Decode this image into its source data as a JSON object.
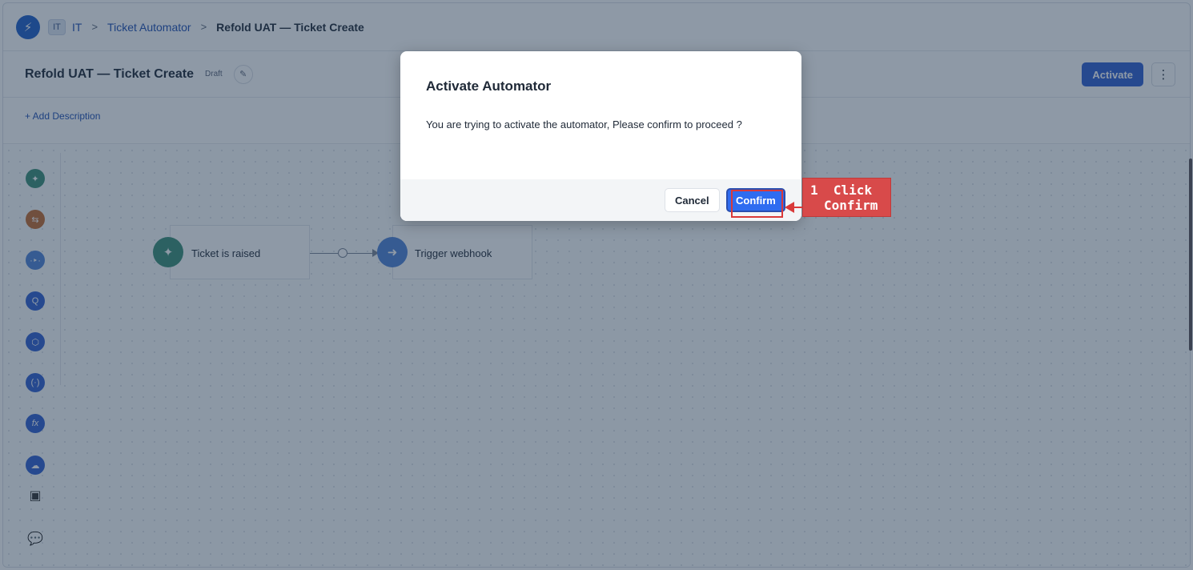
{
  "topbar": {
    "workspace_badge": "IT",
    "breadcrumbs": [
      "IT",
      "Ticket Automator",
      "Refold UAT — Ticket Create"
    ],
    "separator": ">"
  },
  "header": {
    "title": "Refold UAT — Ticket Create",
    "status": "Draft",
    "activate_label": "Activate",
    "more_label": "⋮"
  },
  "description": {
    "add_label": "+ Add Description"
  },
  "canvas": {
    "nodes": [
      {
        "label": "Ticket is raised",
        "icon": "trigger-icon"
      },
      {
        "label": "Trigger webhook",
        "icon": "arrow-right-icon"
      }
    ],
    "tools": [
      {
        "icon": "trigger-icon",
        "color": "#3a8f76"
      },
      {
        "icon": "switch-icon",
        "color": "#c26a2e"
      },
      {
        "icon": "webhook-icon",
        "color": "#4e82d6"
      },
      {
        "icon": "query-icon",
        "color": "#2f5fd0"
      },
      {
        "icon": "box-icon",
        "color": "#2f5fd0"
      },
      {
        "icon": "variable-icon",
        "color": "#2f5fd0"
      },
      {
        "icon": "function-icon",
        "color": "#2f5fd0"
      },
      {
        "icon": "cloud-icon",
        "color": "#2f5fd0"
      },
      {
        "icon": "play-book-icon",
        "color": "#333333"
      },
      {
        "icon": "chat-icon",
        "color": "#333333"
      }
    ]
  },
  "modal": {
    "title": "Activate Automator",
    "body": "You are trying to activate the automator, Please confirm to proceed ?",
    "cancel_label": "Cancel",
    "confirm_label": "Confirm"
  },
  "annotation": {
    "step": "1",
    "line1": "Click",
    "line2": "Confirm",
    "color": "#d84a4a"
  }
}
